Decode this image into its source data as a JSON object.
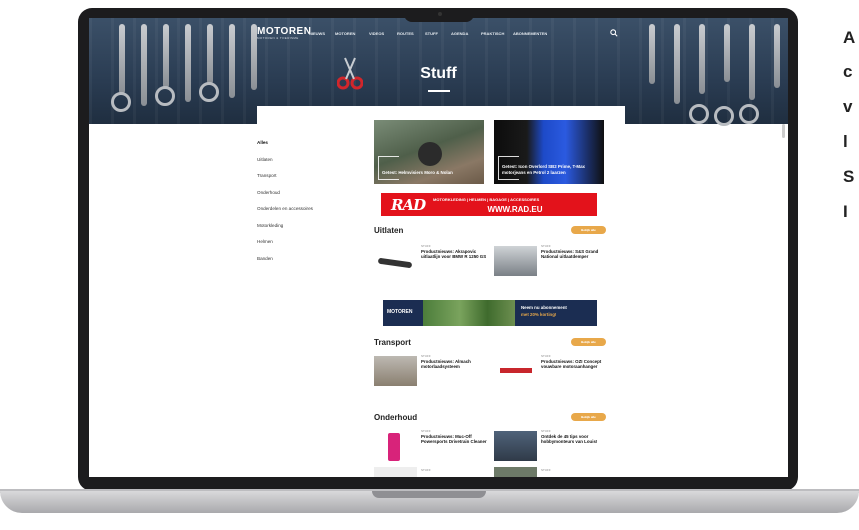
{
  "site": {
    "logo": "MOTOREN",
    "logo_sub": "MOTOREN & TOERISME",
    "nav": [
      "NIEUWS",
      "MOTOREN",
      "VIDEOS",
      "ROUTES",
      "STUFF",
      "AGENDA",
      "PRAKTISCH",
      "ABONNEMENTEN"
    ],
    "page_title": "Stuff"
  },
  "sidebar": {
    "items": [
      "Alles",
      "Uitlaten",
      "Transport",
      "Onderhoud",
      "Onderdelen en accessoires",
      "Motorkleding",
      "Helmen",
      "Banden"
    ]
  },
  "featured": [
    {
      "caption": "Getest: Helmvisiers Moro & Nolan"
    },
    {
      "caption": "Getest: Icon Overlord SB2 Prime, T-Max motorjeans en Petrol 2 laarzen"
    }
  ],
  "rad_banner": {
    "logo": "RAD",
    "tagline": "MOTORKLEDING | HELMEN | BAGAGE | ACCESSOIRES",
    "url": "WWW.RAD.EU"
  },
  "sections": [
    {
      "title": "Uitlaten",
      "button": "Bekijk alle",
      "items": [
        {
          "tag": "STUFF",
          "title": "Productnieuws: Akrapovic uitlaatlijn voor BMW R 1250 GS"
        },
        {
          "tag": "STUFF",
          "title": "Productnieuws: S&S Grand National uitlaatdemper"
        }
      ]
    },
    {
      "title": "Transport",
      "button": "Bekijk alle",
      "items": [
        {
          "tag": "STUFF",
          "title": "Productnieuws: Almach motorlaadsysteem"
        },
        {
          "tag": "STUFF",
          "title": "Productnieuws: OZI Concept vouwbare motoraanhanger"
        }
      ]
    },
    {
      "title": "Onderhoud",
      "button": "Bekijk alle",
      "items": [
        {
          "tag": "STUFF",
          "title": "Productnieuws: Muc-Off Powersports Drivetrain Cleaner"
        },
        {
          "tag": "STUFF",
          "title": "Ontdek de 45 tips voor hobbymonteurs van Louis!"
        },
        {
          "tag": "STUFF",
          "title": ""
        },
        {
          "tag": "STUFF",
          "title": ""
        }
      ]
    }
  ],
  "sub_banner": {
    "logo": "MOTOREN",
    "text1": "Neem nu abonnement",
    "text2": "met 20% korting!"
  },
  "side_text": [
    "A",
    "c",
    "v",
    "l",
    "S",
    "I"
  ],
  "colors": {
    "accent": "#e8a84a",
    "rad_red": "#e3121b",
    "navy": "#1b2d52"
  }
}
